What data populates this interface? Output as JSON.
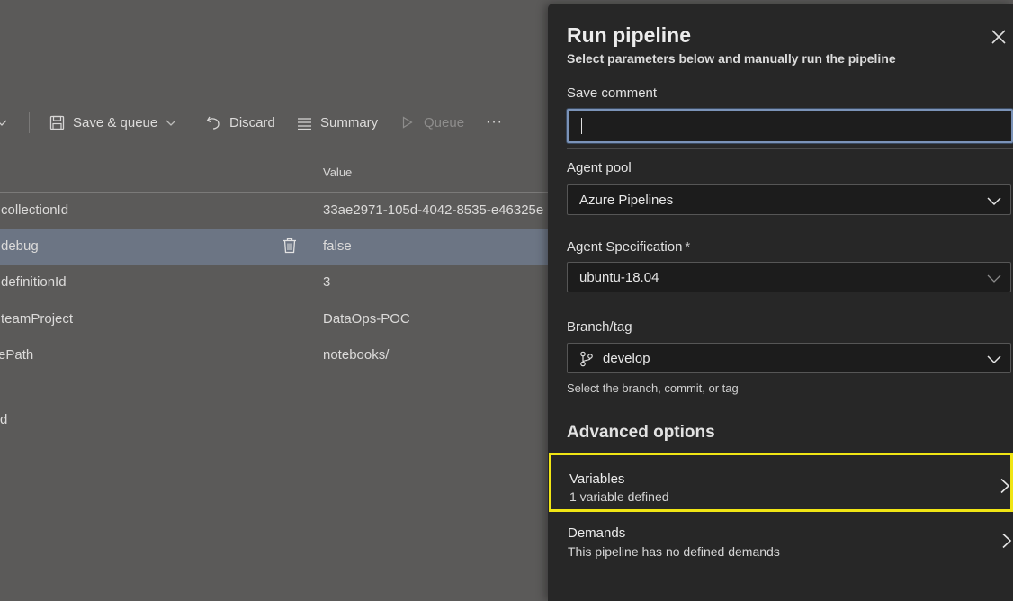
{
  "toolbar": {
    "save_queue_label": "Save & queue",
    "discard_label": "Discard",
    "summary_label": "Summary",
    "queue_label": "Queue",
    "more_label": "···"
  },
  "variables_grid": {
    "value_header": "Value",
    "rows": [
      {
        "name": "collectionId",
        "value": "33ae2971-105d-4042-8535-e46325e"
      },
      {
        "name": "debug",
        "value": "false",
        "selected": true
      },
      {
        "name": "definitionId",
        "value": "3"
      },
      {
        "name": "teamProject",
        "value": "DataOps-POC"
      },
      {
        "name": "ePath",
        "value": "notebooks/"
      }
    ],
    "stray_text": "d"
  },
  "panel": {
    "title": "Run pipeline",
    "subtitle": "Select parameters below and manually run the pipeline",
    "save_comment_label": "Save comment",
    "save_comment_value": "",
    "agent_pool_label": "Agent pool",
    "agent_pool_value": "Azure Pipelines",
    "agent_spec_label": "Agent Specification",
    "agent_spec_required": "*",
    "agent_spec_value": "ubuntu-18.04",
    "branch_label": "Branch/tag",
    "branch_value": "develop",
    "branch_help": "Select the branch, commit, or tag",
    "advanced_label": "Advanced options",
    "variables_title": "Variables",
    "variables_desc": "1 variable defined",
    "demands_title": "Demands",
    "demands_desc": "This pipeline has no defined demands"
  },
  "colors": {
    "highlight": "#f0e514",
    "panel_bg": "#272727",
    "page_bg": "#5b5a59",
    "selected_row": "#6c7584"
  }
}
